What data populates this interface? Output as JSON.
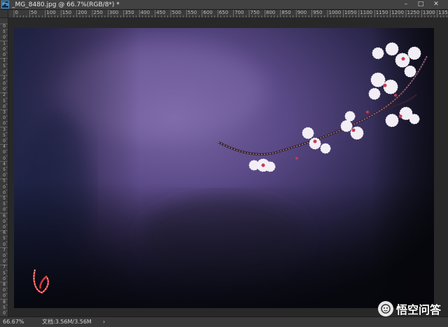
{
  "window": {
    "app_icon": "Ps",
    "title": "_MG_8480.jpg @ 66.7%(RGB/8*) *",
    "controls": {
      "minimize": "–",
      "restore": "□",
      "close": "✕"
    }
  },
  "ruler": {
    "horizontal": [
      "0",
      "50",
      "100",
      "150",
      "200",
      "250",
      "300",
      "350",
      "400",
      "450",
      "500",
      "550",
      "600",
      "650",
      "700",
      "750",
      "800",
      "850",
      "900",
      "950",
      "1000",
      "1050",
      "1100",
      "1150",
      "1200",
      "1250",
      "1300",
      "1350"
    ],
    "vertical": [
      "0",
      "5",
      "0",
      "1",
      "0",
      "0",
      "1",
      "5",
      "0",
      "2",
      "0",
      "0",
      "2",
      "5",
      "0",
      "3",
      "0",
      "0",
      "3",
      "5",
      "0",
      "4",
      "0",
      "0",
      "4",
      "5",
      "0",
      "5",
      "0",
      "0",
      "5",
      "5",
      "0",
      "6",
      "0",
      "0",
      "6",
      "5",
      "0",
      "7",
      "0",
      "0",
      "7",
      "5",
      "0",
      "8",
      "0",
      "0",
      "8",
      "5",
      "0"
    ]
  },
  "image": {
    "name": "_MG_8480.jpg",
    "subject": "blossom-branch-photo",
    "colors": {
      "bg_light": "#6e5a98",
      "bg_mid": "#3f3566",
      "bg_dark": "#0f1018",
      "petal": "#f3eef6",
      "bud": "#c73a4e",
      "branch": "#3a2030"
    }
  },
  "status": {
    "zoom": "66.67%",
    "doc_size": "文档:3.56M/3.56M",
    "arrow": "›"
  },
  "watermark": {
    "text": "悟空问答",
    "icon": "wukong-logo-icon"
  }
}
